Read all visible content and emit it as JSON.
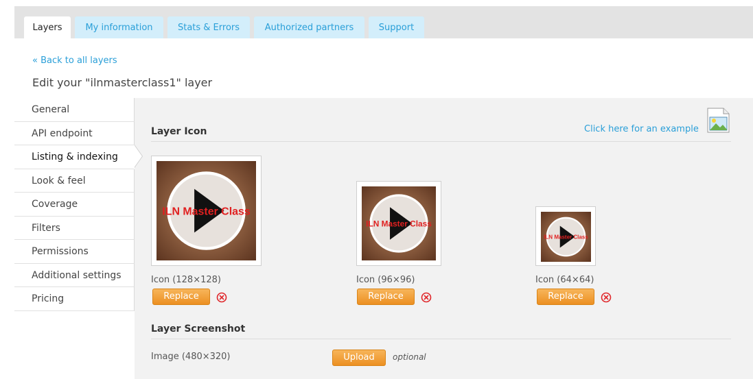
{
  "tabs": [
    {
      "label": "Layers",
      "active": true
    },
    {
      "label": "My information",
      "active": false
    },
    {
      "label": "Stats & Errors",
      "active": false
    },
    {
      "label": "Authorized partners",
      "active": false
    },
    {
      "label": "Support",
      "active": false
    }
  ],
  "back_link": "« Back to all layers",
  "page_title": "Edit your \"ilnmasterclass1\" layer",
  "sidenav": [
    {
      "label": "General",
      "active": false
    },
    {
      "label": "API endpoint",
      "active": false
    },
    {
      "label": "Listing & indexing",
      "active": true
    },
    {
      "label": "Look & feel",
      "active": false
    },
    {
      "label": "Coverage",
      "active": false
    },
    {
      "label": "Filters",
      "active": false
    },
    {
      "label": "Permissions",
      "active": false
    },
    {
      "label": "Additional settings",
      "active": false
    },
    {
      "label": "Pricing",
      "active": false
    }
  ],
  "layer_icon": {
    "title": "Layer Icon",
    "example_link": "Click here for an example",
    "icon_text": "ILN Master Class",
    "icons": [
      {
        "label": "Icon (128×128)",
        "button": "Replace"
      },
      {
        "label": "Icon (96×96)",
        "button": "Replace"
      },
      {
        "label": "Icon (64×64)",
        "button": "Replace"
      }
    ]
  },
  "layer_screenshot": {
    "title": "Layer Screenshot",
    "image_label": "Image (480×320)",
    "button": "Upload",
    "optional": "optional"
  },
  "colors": {
    "link": "#2a9fd8",
    "button": "#ec9022",
    "remove": "#e0262a",
    "icon_text": "#e02020"
  }
}
